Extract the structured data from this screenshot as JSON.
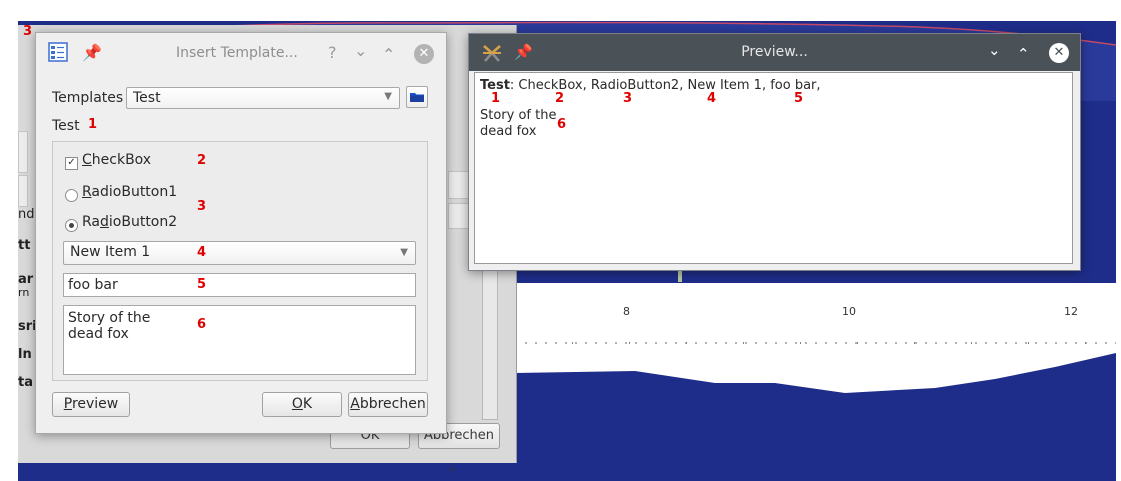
{
  "background_app": {
    "corner_marker": "3",
    "dialog_glyphs": [
      "nd",
      "tt",
      "ar",
      "rn",
      "sri",
      "ln",
      "ta"
    ],
    "buttons": {
      "ok_label": "OK",
      "cancel_label": "Abbrechen"
    },
    "axis_ticks": [
      "8",
      "10",
      "12"
    ],
    "colors": {
      "plot_fill": "#1f2d8a",
      "background": "#ffffff"
    }
  },
  "template_dialog": {
    "title": "Insert Template...",
    "help_glyph": "?",
    "templates_label": "Templates",
    "templates_selected": "Test",
    "section_label": "Test",
    "checkbox": {
      "label_prefix": "",
      "label_access": "C",
      "label_rest": "heckBox",
      "checked": true,
      "mark": "✓"
    },
    "radio1": {
      "label_access": "R",
      "label_rest": "adioButton1",
      "selected": false
    },
    "radio2": {
      "label_prefix": "Ra",
      "label_access": "d",
      "label_rest": "ioButton2",
      "selected": true
    },
    "dropdown_value": "New Item 1",
    "line_edit_value": "foo bar",
    "text_edit_lines": [
      "Story of the",
      "dead fox"
    ],
    "preview_button": {
      "access": "P",
      "rest": "review"
    },
    "ok_button": {
      "access": "O",
      "rest": "K"
    },
    "cancel_button": {
      "access": "A",
      "rest": "bbrechen"
    },
    "markers": [
      "1",
      "2",
      "3",
      "4",
      "5",
      "6"
    ]
  },
  "preview_window": {
    "title": "Preview...",
    "line1_bold": "Test",
    "line1_rest": ": CheckBox, RadioButton2, New Item 1, foo bar,",
    "line2": "Story of the",
    "line3": "dead fox",
    "markers": [
      "1",
      "2",
      "3",
      "4",
      "5",
      "6"
    ]
  }
}
